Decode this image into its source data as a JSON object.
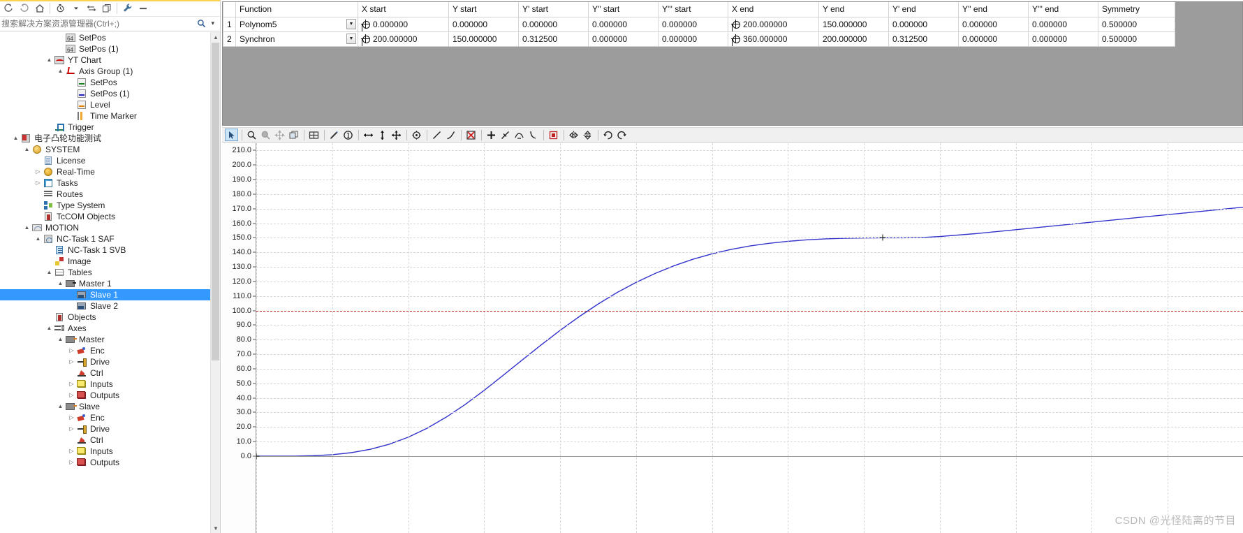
{
  "solution_explorer": {
    "search": {
      "placeholder": "搜索解决方案资源管理器(Ctrl+;)",
      "value": ""
    },
    "toolbar": [
      {
        "name": "back-icon",
        "glyph": "◁"
      },
      {
        "name": "forward-icon",
        "glyph": "▷"
      },
      {
        "name": "home-icon",
        "glyph": "⌂"
      },
      {
        "name": "pending-changes-icon",
        "glyph": "◴"
      },
      {
        "name": "chevron-down-icon",
        "glyph": "▾"
      },
      {
        "name": "sync-icon",
        "glyph": "⇄"
      },
      {
        "name": "copy-icon",
        "glyph": "⧉"
      },
      {
        "name": "properties-icon",
        "glyph": "ὒ7"
      },
      {
        "name": "collapse-icon",
        "glyph": "➖"
      }
    ],
    "tree": [
      {
        "label": "SetPos",
        "indent": 5,
        "expander": "",
        "icon": "ic-chart64",
        "selected": false
      },
      {
        "label": "SetPos (1)",
        "indent": 5,
        "expander": "",
        "icon": "ic-chart64",
        "selected": false
      },
      {
        "label": "YT Chart",
        "indent": 4,
        "expander": "▲",
        "icon": "ic-yt",
        "selected": false
      },
      {
        "label": "Axis Group (1)",
        "indent": 5,
        "expander": "▲",
        "icon": "ic-axisg",
        "selected": false
      },
      {
        "label": "SetPos",
        "indent": 6,
        "expander": "",
        "icon": "ic-sp-green",
        "selected": false
      },
      {
        "label": "SetPos (1)",
        "indent": 6,
        "expander": "",
        "icon": "ic-sp-blue",
        "selected": false
      },
      {
        "label": "Level",
        "indent": 6,
        "expander": "",
        "icon": "ic-sp-orange",
        "selected": false
      },
      {
        "label": "Time Marker",
        "indent": 6,
        "expander": "",
        "icon": "ic-timemarker",
        "selected": false
      },
      {
        "label": "Trigger",
        "indent": 4,
        "expander": "",
        "icon": "ic-trigger",
        "selected": false
      },
      {
        "label": "电子凸轮功能测试",
        "indent": 1,
        "expander": "▲",
        "icon": "ic-project",
        "selected": false
      },
      {
        "label": "SYSTEM",
        "indent": 2,
        "expander": "▲",
        "icon": "ic-system",
        "selected": false
      },
      {
        "label": "License",
        "indent": 3,
        "expander": "",
        "icon": "ic-license",
        "selected": false
      },
      {
        "label": "Real-Time",
        "indent": 3,
        "expander": "▷",
        "icon": "ic-rt",
        "selected": false
      },
      {
        "label": "Tasks",
        "indent": 3,
        "expander": "▷",
        "icon": "ic-tasks",
        "selected": false
      },
      {
        "label": "Routes",
        "indent": 3,
        "expander": "",
        "icon": "ic-routes",
        "selected": false
      },
      {
        "label": "Type System",
        "indent": 3,
        "expander": "",
        "icon": "ic-typesys",
        "selected": false
      },
      {
        "label": "TcCOM Objects",
        "indent": 3,
        "expander": "",
        "icon": "ic-tccom",
        "selected": false
      },
      {
        "label": "MOTION",
        "indent": 2,
        "expander": "▲",
        "icon": "ic-motion",
        "selected": false
      },
      {
        "label": "NC-Task 1 SAF",
        "indent": 3,
        "expander": "▲",
        "icon": "ic-saf",
        "selected": false
      },
      {
        "label": "NC-Task 1 SVB",
        "indent": 4,
        "expander": "",
        "icon": "ic-svb",
        "selected": false
      },
      {
        "label": "Image",
        "indent": 4,
        "expander": "",
        "icon": "ic-image",
        "selected": false
      },
      {
        "label": "Tables",
        "indent": 4,
        "expander": "▲",
        "icon": "ic-tables",
        "selected": false
      },
      {
        "label": "Master 1",
        "indent": 5,
        "expander": "▲",
        "icon": "ic-master",
        "selected": false
      },
      {
        "label": "Slave 1",
        "indent": 6,
        "expander": "",
        "icon": "ic-slave",
        "selected": true
      },
      {
        "label": "Slave 2",
        "indent": 6,
        "expander": "",
        "icon": "ic-slave",
        "selected": false
      },
      {
        "label": "Objects",
        "indent": 4,
        "expander": "",
        "icon": "ic-objects",
        "selected": false
      },
      {
        "label": "Axes",
        "indent": 4,
        "expander": "▲",
        "icon": "ic-axes",
        "selected": false
      },
      {
        "label": "Master",
        "indent": 5,
        "expander": "▲",
        "icon": "ic-axis",
        "selected": false
      },
      {
        "label": "Enc",
        "indent": 6,
        "expander": "▷",
        "icon": "ic-enc",
        "selected": false
      },
      {
        "label": "Drive",
        "indent": 6,
        "expander": "▷",
        "icon": "ic-drive",
        "selected": false
      },
      {
        "label": "Ctrl",
        "indent": 6,
        "expander": "",
        "icon": "ic-ctrl",
        "selected": false
      },
      {
        "label": "Inputs",
        "indent": 6,
        "expander": "▷",
        "icon": "ic-inputs",
        "selected": false
      },
      {
        "label": "Outputs",
        "indent": 6,
        "expander": "▷",
        "icon": "ic-outputs",
        "selected": false
      },
      {
        "label": "Slave",
        "indent": 5,
        "expander": "▲",
        "icon": "ic-axis",
        "selected": false
      },
      {
        "label": "Enc",
        "indent": 6,
        "expander": "▷",
        "icon": "ic-enc",
        "selected": false
      },
      {
        "label": "Drive",
        "indent": 6,
        "expander": "▷",
        "icon": "ic-drive",
        "selected": false
      },
      {
        "label": "Ctrl",
        "indent": 6,
        "expander": "",
        "icon": "ic-ctrl",
        "selected": false
      },
      {
        "label": "Inputs",
        "indent": 6,
        "expander": "▷",
        "icon": "ic-inputs",
        "selected": false
      },
      {
        "label": "Outputs",
        "indent": 6,
        "expander": "▷",
        "icon": "ic-outputs",
        "selected": false
      }
    ]
  },
  "cam_table": {
    "columns": [
      {
        "key": "row",
        "label": "",
        "width": 18
      },
      {
        "key": "function",
        "label": "Function",
        "width": 175
      },
      {
        "key": "xstart",
        "label": "X start",
        "width": 130
      },
      {
        "key": "ystart",
        "label": "Y start",
        "width": 100
      },
      {
        "key": "y1start",
        "label": "Y' start",
        "width": 100
      },
      {
        "key": "y2start",
        "label": "Y'' start",
        "width": 100
      },
      {
        "key": "y3start",
        "label": "Y''' start",
        "width": 100
      },
      {
        "key": "xend",
        "label": "X end",
        "width": 130
      },
      {
        "key": "yend",
        "label": "Y end",
        "width": 100
      },
      {
        "key": "y1end",
        "label": "Y' end",
        "width": 100
      },
      {
        "key": "y2end",
        "label": "Y'' end",
        "width": 100
      },
      {
        "key": "y3end",
        "label": "Y''' end",
        "width": 100
      },
      {
        "key": "symmetry",
        "label": "Symmetry",
        "width": 110
      }
    ],
    "rows": [
      {
        "row": "1",
        "function": "Polynom5",
        "xstart": "0.000000",
        "ystart": "0.000000",
        "y1start": "0.000000",
        "y2start": "0.000000",
        "y3start": "0.000000",
        "xend": "200.000000",
        "yend": "150.000000",
        "y1end": "0.000000",
        "y2end": "0.000000",
        "y3end": "0.000000",
        "symmetry": "0.500000"
      },
      {
        "row": "2",
        "function": "Synchron",
        "xstart": "200.000000",
        "ystart": "150.000000",
        "y1start": "0.312500",
        "y2start": "0.000000",
        "y3start": "0.000000",
        "xend": "360.000000",
        "yend": "200.000000",
        "y1end": "0.312500",
        "y2end": "0.000000",
        "y3end": "0.000000",
        "symmetry": "0.500000"
      }
    ]
  },
  "chart_toolbar": {
    "groups": [
      [
        {
          "name": "pointer-select-icon",
          "glyph": "➤",
          "state": "active"
        }
      ],
      [
        {
          "name": "zoom-in-icon",
          "glyph": "⚲",
          "state": "normal"
        },
        {
          "name": "zoom-region-icon",
          "glyph": "⬟",
          "state": "disabled"
        },
        {
          "name": "pan-move-icon",
          "glyph": "✥",
          "state": "disabled"
        },
        {
          "name": "zoom-reset-icon",
          "glyph": "⧉",
          "state": "normal"
        }
      ],
      [
        {
          "name": "grid-toggle-icon",
          "glyph": "⊞",
          "state": "normal"
        }
      ],
      [
        {
          "name": "pencil-edit-icon",
          "glyph": "✐",
          "state": "normal"
        },
        {
          "name": "point-number-icon",
          "glyph": "①",
          "state": "normal"
        }
      ],
      [
        {
          "name": "move-horizontal-icon",
          "glyph": "↔",
          "state": "normal"
        },
        {
          "name": "move-vertical-icon",
          "glyph": "↕",
          "state": "normal"
        },
        {
          "name": "move-free-icon",
          "glyph": "✥",
          "state": "normal"
        }
      ],
      [
        {
          "name": "point-center-icon",
          "glyph": "⊕",
          "state": "normal"
        }
      ],
      [
        {
          "name": "line-straight-icon",
          "glyph": "╱",
          "state": "normal"
        },
        {
          "name": "line-curve-icon",
          "glyph": "↗",
          "state": "normal"
        }
      ],
      [
        {
          "name": "delete-segment-icon",
          "glyph": "☒",
          "state": "normal"
        }
      ],
      [
        {
          "name": "add-point-icon",
          "glyph": "＋",
          "state": "normal"
        },
        {
          "name": "tangent-icon",
          "glyph": "↗",
          "state": "normal"
        },
        {
          "name": "peak-icon",
          "glyph": "⋀",
          "state": "normal"
        },
        {
          "name": "slope-icon",
          "glyph": "⤷",
          "state": "normal"
        }
      ],
      [
        {
          "name": "stop-marker-icon",
          "glyph": "■",
          "state": "normal"
        }
      ],
      [
        {
          "name": "mirror-horizontal-icon",
          "glyph": "⫞",
          "state": "normal"
        },
        {
          "name": "mirror-vertical-icon",
          "glyph": "⫠",
          "state": "normal"
        }
      ],
      [
        {
          "name": "undo-icon",
          "glyph": "↶",
          "state": "normal"
        },
        {
          "name": "redo-icon",
          "glyph": "↷",
          "state": "normal"
        }
      ]
    ]
  },
  "chart_data": {
    "type": "line",
    "title": "",
    "xlabel": "",
    "ylabel": "",
    "ylim": [
      0,
      215
    ],
    "xlim": [
      0,
      520
    ],
    "yticks": [
      0.0,
      10.0,
      20.0,
      30.0,
      40.0,
      50.0,
      60.0,
      70.0,
      80.0,
      90.0,
      100.0,
      110.0,
      120.0,
      130.0,
      140.0,
      150.0,
      160.0,
      170.0,
      180.0,
      190.0,
      200.0,
      210.0
    ],
    "ytick_labels": [
      "0.0",
      "10.0",
      "20.0",
      "30.0",
      "40.0",
      "50.0",
      "60.0",
      "70.0",
      "80.0",
      "90.0",
      "100.0",
      "110.0",
      "120.0",
      "130.0",
      "140.0",
      "150.0",
      "160.0",
      "170.0",
      "180.0",
      "190.0",
      "200.0",
      "210.0"
    ],
    "grid": true,
    "legend": null,
    "series": [
      {
        "name": "SetPos",
        "color": "#3333cc",
        "points": [
          [
            0,
            0
          ],
          [
            10,
            0
          ],
          [
            20,
            0.05
          ],
          [
            30,
            0.3
          ],
          [
            40,
            1.0
          ],
          [
            50,
            2.4
          ],
          [
            60,
            4.7
          ],
          [
            70,
            8.2
          ],
          [
            80,
            13.0
          ],
          [
            90,
            19.2
          ],
          [
            100,
            26.8
          ],
          [
            110,
            35.5
          ],
          [
            120,
            45.2
          ],
          [
            130,
            55.5
          ],
          [
            140,
            66.0
          ],
          [
            150,
            76.4
          ],
          [
            160,
            86.4
          ],
          [
            170,
            95.8
          ],
          [
            180,
            104.5
          ],
          [
            190,
            112.4
          ],
          [
            200,
            119.4
          ],
          [
            210,
            125.5
          ],
          [
            220,
            130.8
          ],
          [
            230,
            135.3
          ],
          [
            240,
            139.0
          ],
          [
            250,
            142.0
          ],
          [
            260,
            144.4
          ],
          [
            270,
            146.2
          ],
          [
            280,
            147.6
          ],
          [
            290,
            148.6
          ],
          [
            300,
            149.3
          ],
          [
            310,
            149.7
          ],
          [
            320,
            149.9
          ],
          [
            330,
            150.0
          ],
          [
            340,
            150.0
          ],
          [
            350,
            150.2
          ],
          [
            360,
            150.9
          ],
          [
            380,
            153.0
          ],
          [
            400,
            155.6
          ],
          [
            430,
            159.5
          ],
          [
            460,
            163.4
          ],
          [
            500,
            168.5
          ],
          [
            540,
            173.7
          ],
          [
            580,
            178.8
          ],
          [
            620,
            184.0
          ],
          [
            660,
            189.1
          ],
          [
            700,
            194.3
          ],
          [
            740,
            199.4
          ],
          [
            780,
            204.5
          ],
          [
            820,
            209.0
          ]
        ]
      }
    ],
    "annotations": [
      {
        "type": "hline",
        "name": "level-line",
        "y": 100.0,
        "color": "#c02020",
        "style": "dashed"
      },
      {
        "type": "marker",
        "name": "segment-point",
        "x": 330,
        "y": 150.0,
        "shape": "cross",
        "color": "#111111"
      },
      {
        "type": "marker",
        "name": "origin-point",
        "x": 0,
        "y": 0.0,
        "shape": "cross",
        "color": "#111111"
      }
    ]
  },
  "watermark": {
    "text": "CSDN @光怪陆离的节目"
  }
}
